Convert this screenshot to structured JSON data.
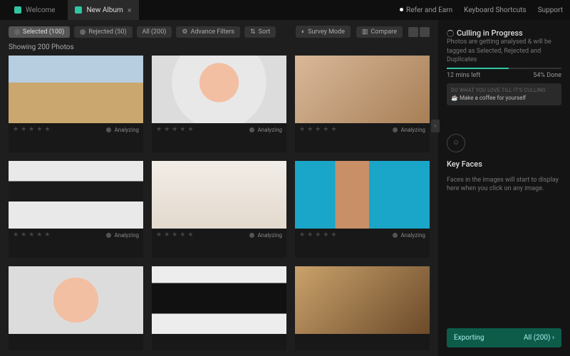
{
  "tabs": [
    {
      "label": "Welcome",
      "active": false
    },
    {
      "label": "New Album",
      "active": true
    }
  ],
  "topLinks": {
    "refer": "Refer and Earn",
    "shortcuts": "Keyboard Shortcuts",
    "support": "Support"
  },
  "filters": {
    "selected": {
      "label": "Selected (100)"
    },
    "rejected": {
      "label": "Rejected (50)"
    },
    "all": {
      "label": "All (200)"
    },
    "advance": {
      "label": "Advance Filters"
    },
    "sort": {
      "label": "Sort"
    }
  },
  "modes": {
    "survey": "Survey Mode",
    "compare": "Compare"
  },
  "showing": "Showing 200 Photos",
  "cardStatus": "Analyzing",
  "culling": {
    "title": "Culling in Progress",
    "desc": "Photos are getting analysed & will be tagged as Selected, Rejected and Duplicates",
    "left": "12 mins left",
    "pct": "54% Done"
  },
  "coffee": {
    "tag": "DO WHAT YOU LOVE TILL IT'S CULLING",
    "msg": "☕ Make a coffee for yourself"
  },
  "keyfaces": {
    "title": "Key Faces",
    "desc": "Faces in the images will start to display here when you click on any image."
  },
  "export": {
    "label": "Exporting",
    "count": "All (200)"
  }
}
